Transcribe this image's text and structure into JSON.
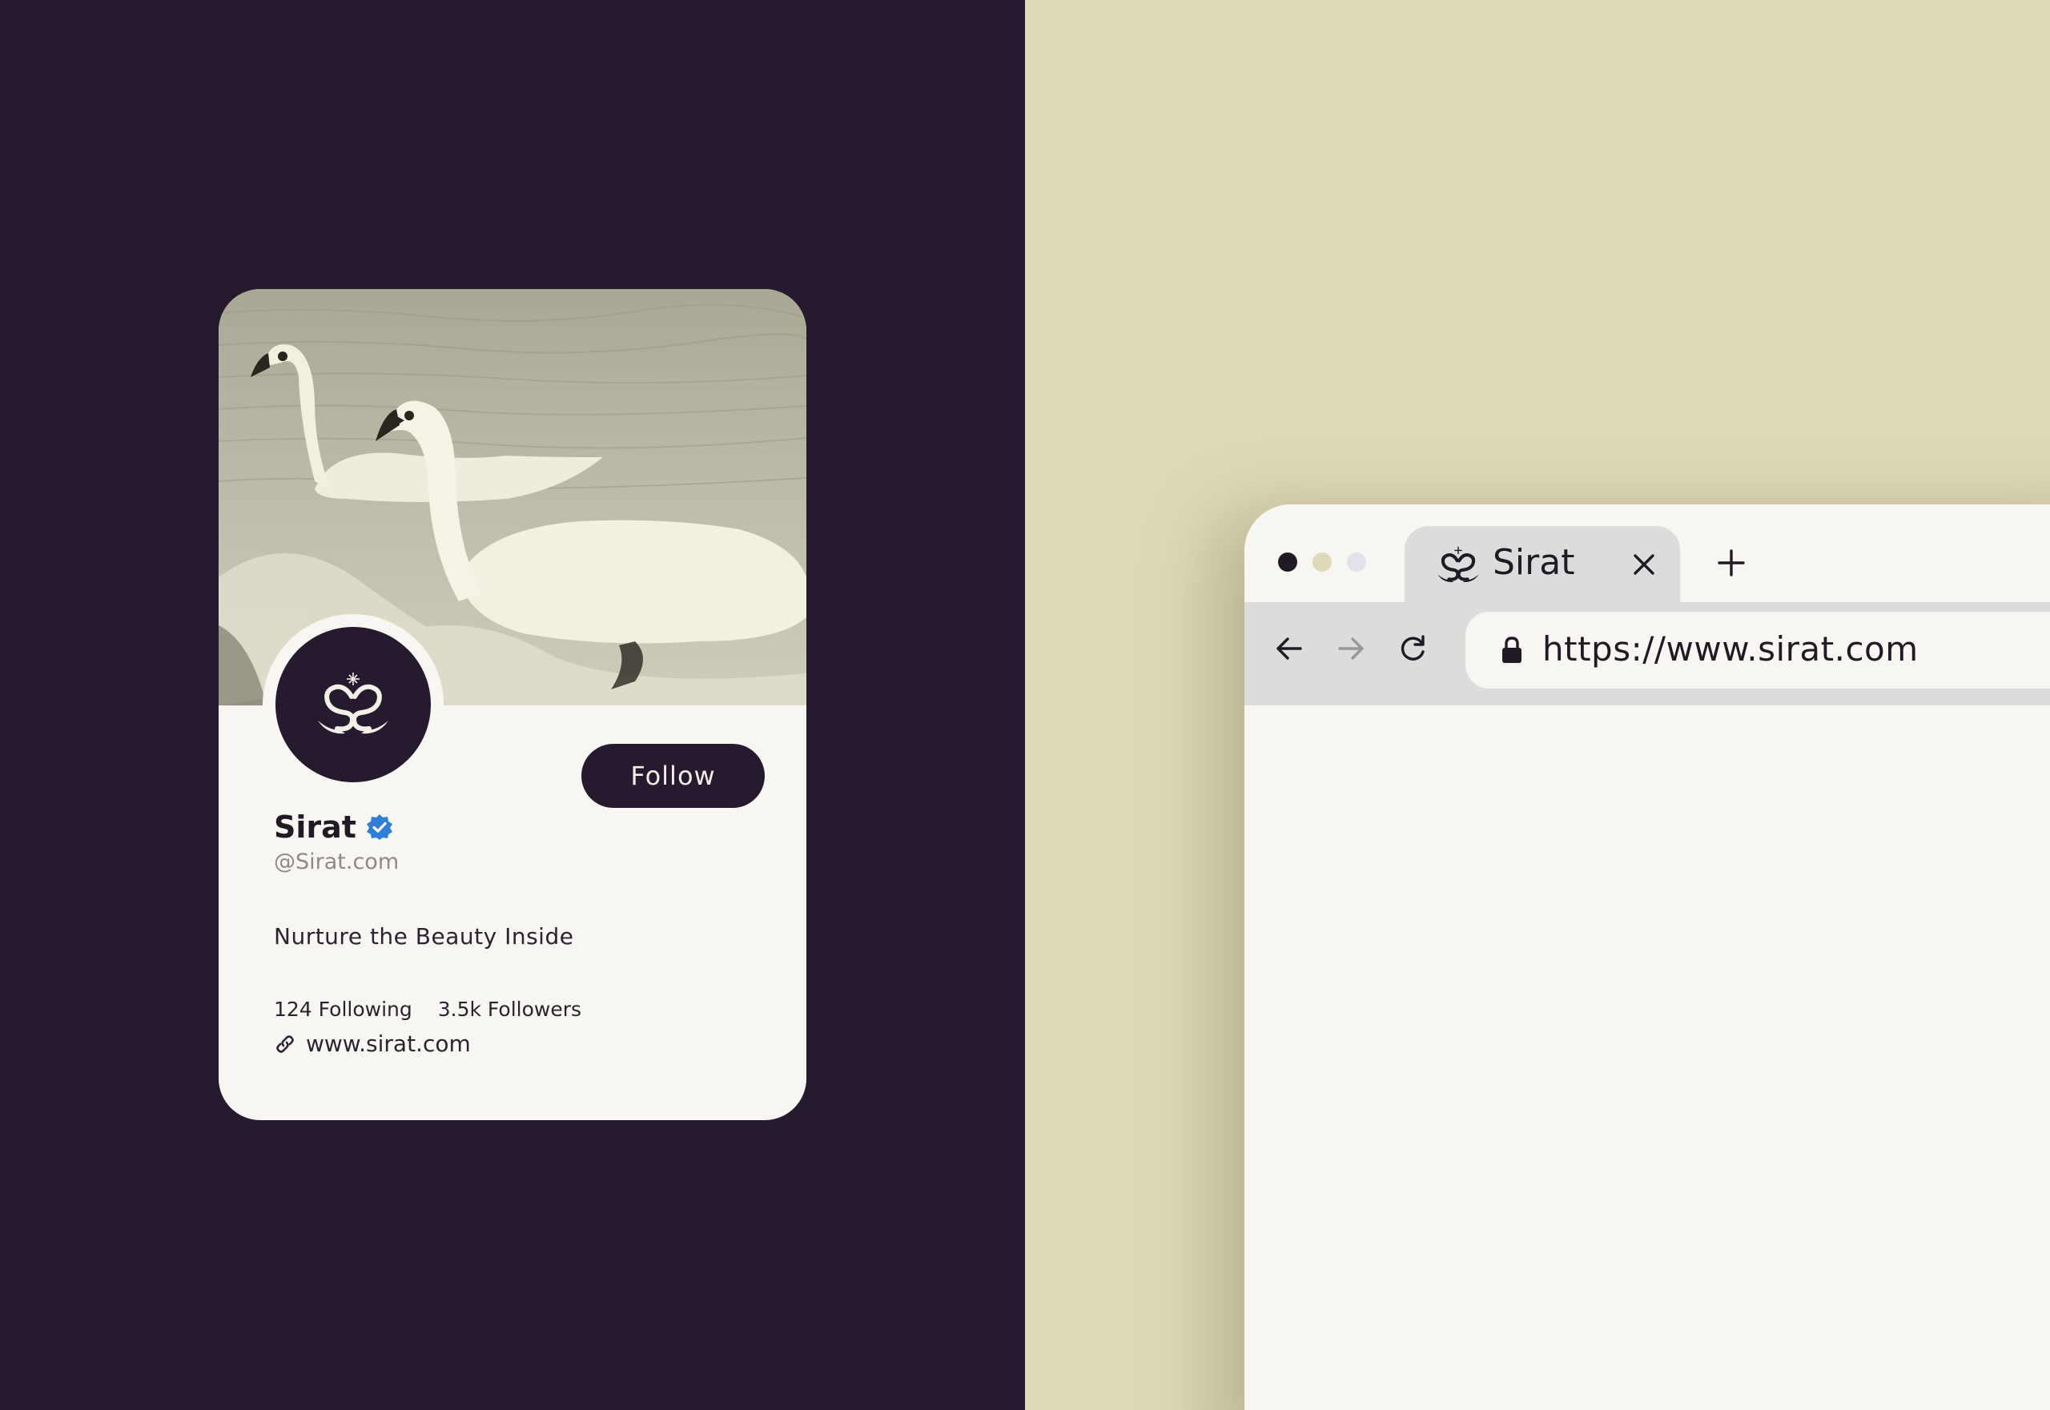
{
  "colors": {
    "left_background": "#261a2e",
    "right_background": "#dddab9",
    "card_background": "#f7f6f2",
    "brand_dark": "#261a2e",
    "verified_blue": "#2f7fd6",
    "browser_chrome": "#dcdcdc"
  },
  "profile_card": {
    "cover_image": "swans-on-water",
    "avatar_icon": "sirat-swan-logo-icon",
    "follow_label": "Follow",
    "display_name": "Sirat",
    "verified_icon": "verified-badge-icon",
    "handle": "@Sirat.com",
    "bio": "Nurture the Beauty Inside",
    "following": "124 Following",
    "followers": "3.5k Followers",
    "link_icon": "link-icon",
    "website": "www.sirat.com"
  },
  "browser": {
    "window_controls": [
      "close-dot",
      "minimize-dot",
      "maximize-dot"
    ],
    "tab": {
      "icon": "sirat-swan-logo-icon",
      "title": "Sirat",
      "close_icon": "close-icon"
    },
    "new_tab_icon": "plus-icon",
    "nav": {
      "back_icon": "arrow-left-icon",
      "forward_icon": "arrow-right-icon",
      "reload_icon": "reload-icon"
    },
    "lock_icon": "lock-icon",
    "url": "https://www.sirat.com"
  }
}
